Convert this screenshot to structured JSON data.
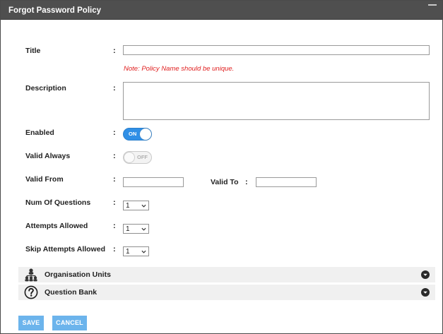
{
  "dialog": {
    "title": "Forgot Password Policy"
  },
  "form": {
    "separator": ":",
    "title_label": "Title",
    "title_value": "",
    "note": "Note: Policy Name should be unique.",
    "description_label": "Description",
    "description_value": "",
    "enabled_label": "Enabled",
    "enabled_toggle_text": "ON",
    "enabled_state": true,
    "valid_always_label": "Valid Always",
    "valid_always_toggle_text": "OFF",
    "valid_always_state": false,
    "valid_from_label": "Valid From",
    "valid_from_value": "",
    "valid_to_label": "Valid To",
    "valid_to_value": "",
    "num_questions_label": "Num Of Questions",
    "num_questions_value": "1",
    "attempts_label": "Attempts Allowed",
    "attempts_value": "1",
    "skip_attempts_label": "Skip Attempts Allowed",
    "skip_attempts_value": "1"
  },
  "sections": [
    {
      "label": "Organisation Units",
      "icon": "org-hierarchy-icon",
      "expanded": false
    },
    {
      "label": "Question Bank",
      "icon": "question-circle-icon",
      "expanded": false
    }
  ],
  "buttons": {
    "save": "SAVE",
    "cancel": "CANCEL"
  },
  "colors": {
    "titlebar": "#4f4f4f",
    "toggle_on": "#2f8fe6",
    "button": "#6cb4ec",
    "note": "#e02020",
    "section_bg": "#f0f0f0"
  }
}
